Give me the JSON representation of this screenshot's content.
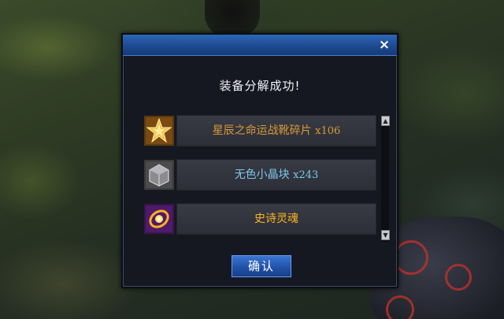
{
  "dialog": {
    "close_glyph": "×",
    "message": "装备分解成功!",
    "confirm_label": "确认",
    "scroll_up_glyph": "▲",
    "scroll_down_glyph": "▼",
    "items": [
      {
        "name": "星辰之命运战靴碎片",
        "qty": "x106",
        "color": "#d89a35",
        "icon": "star-shard-icon"
      },
      {
        "name": "无色小晶块",
        "qty": "x243",
        "color": "#7ec8e8",
        "icon": "colorless-crystal-icon"
      },
      {
        "name": "史诗灵魂",
        "qty": "",
        "color": "#ffb51e",
        "icon": "epic-soul-icon"
      }
    ]
  },
  "colors": {
    "titlebar": "#1d4a92",
    "panel": "#151821",
    "row_bg": "#383a44",
    "button": "#2252a8"
  }
}
